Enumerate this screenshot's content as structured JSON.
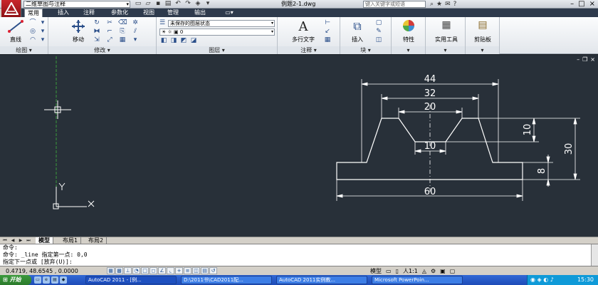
{
  "app": {
    "workspace": "二维草图与注释",
    "window_title": "例题2-1.dwg",
    "search_placeholder": "键入关键字或短语"
  },
  "tabs": [
    "常用",
    "插入",
    "注释",
    "参数化",
    "视图",
    "管理",
    "输出"
  ],
  "ribbon": {
    "panels": {
      "draw": "绘图",
      "modify": "修改",
      "layers": "图层",
      "annotation": "注释",
      "block": "块"
    },
    "buttons": {
      "line": "直线",
      "move": "移动",
      "mtext": "多行文字",
      "insert": "插入",
      "properties": "特性",
      "utilities": "实用工具",
      "clipboard": "剪贴板"
    },
    "layer_state": "未保存的图层状态",
    "layer_current": "0"
  },
  "drawing": {
    "dimensions": {
      "d44": "44",
      "d32": "32",
      "d20": "20",
      "d10h": "10",
      "d10v": "10",
      "d30": "30",
      "d8": "8",
      "d60": "60"
    },
    "ucs": {
      "y": "Y",
      "x": "X"
    }
  },
  "layout_tabs": [
    "模型",
    "布局1",
    "布局2"
  ],
  "command_line": {
    "line1": "命令:",
    "line2": "命令: _line 指定第一点: 0,0",
    "line3": "指定下一点或 [放弃(U)]:"
  },
  "status": {
    "coords": "0.4719,  48.6545 , 0.0000",
    "model": "模型",
    "scale": "人1:1"
  },
  "taskbar": {
    "start": "开始",
    "tasks": [
      "AutoCAD 2011 - [例...",
      "D:\\2011书\\CAD2011配...",
      "AutoCAD 2011实例教...",
      "Microsoft PowerPoin..."
    ],
    "clock": "15:30"
  },
  "colors": {
    "canvas": "#283039",
    "geometry": "#ffffff",
    "center_line": "#3a9a3a"
  }
}
